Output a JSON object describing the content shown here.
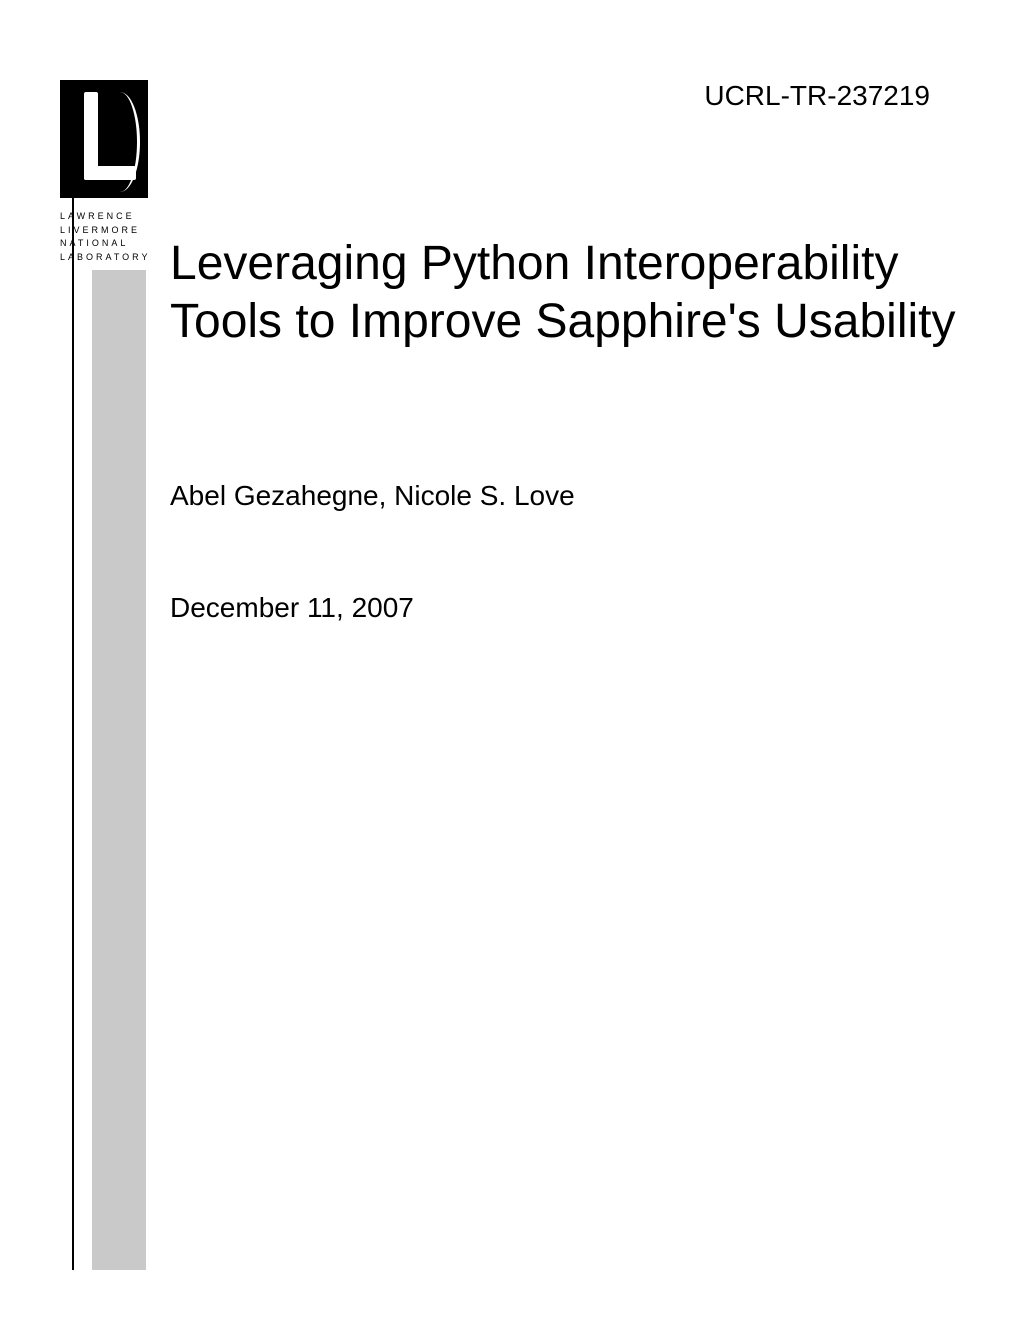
{
  "report_number": "UCRL-TR-237219",
  "lab_name": {
    "line1": "LAWRENCE",
    "line2": "LIVERMORE",
    "line3": "NATIONAL",
    "line4": "LABORATORY"
  },
  "title": "Leveraging Python Interoperability Tools to Improve Sapphire's Usability",
  "authors": "Abel Gezahegne, Nicole S. Love",
  "date": "December 11, 2007"
}
